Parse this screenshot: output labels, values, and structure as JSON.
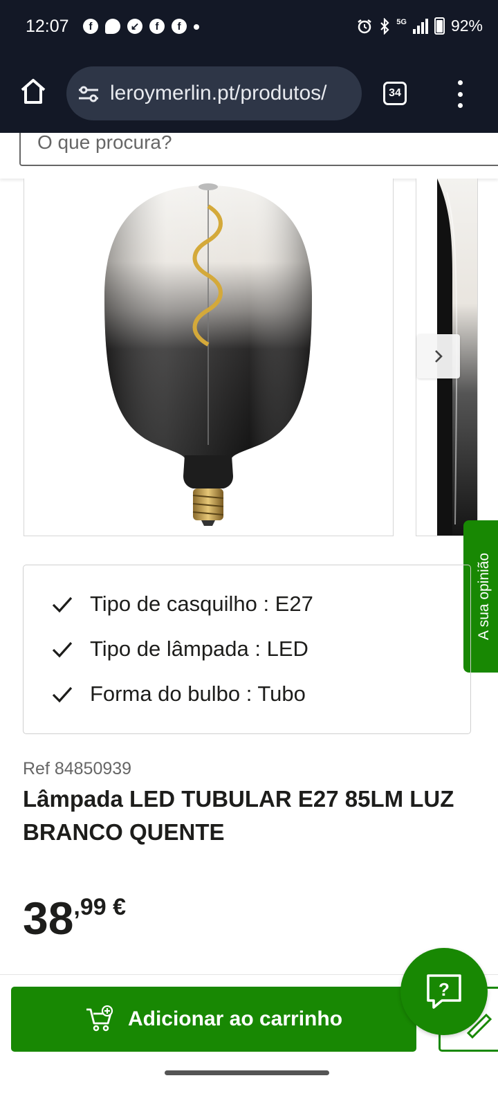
{
  "status_bar": {
    "time": "12:07",
    "network": "5G",
    "battery": "92%"
  },
  "browser": {
    "url": "leroymerlin.pt/produtos/",
    "tab_count": "34"
  },
  "search": {
    "placeholder": "O que procura?"
  },
  "feedback": {
    "label": "A sua opinião"
  },
  "features": [
    {
      "text": "Tipo de casquilho : E27"
    },
    {
      "text": "Tipo de lâmpada : LED"
    },
    {
      "text": "Forma do bulbo : Tubo"
    }
  ],
  "product": {
    "ref": "Ref 84850939",
    "title": "Lâmpada LED TUBULAR E27 85LM LUZ BRANCO QUENTE",
    "price_int": "38",
    "price_dec": ",99 €"
  },
  "actions": {
    "add_to_cart": "Adicionar ao carrinho"
  },
  "colors": {
    "brand_green": "#188803",
    "status_bg": "#131826"
  }
}
